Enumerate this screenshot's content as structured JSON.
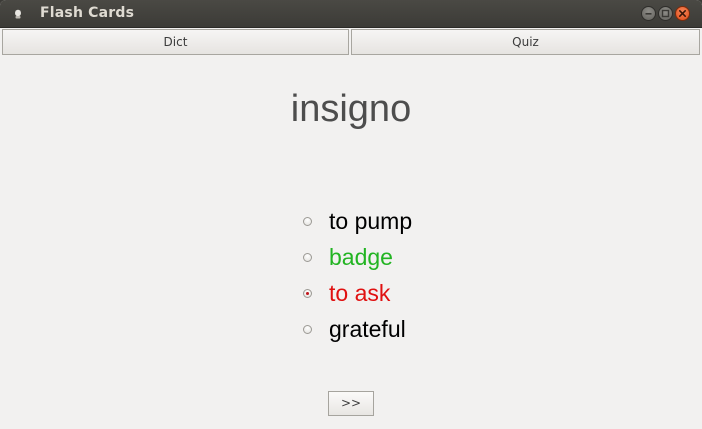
{
  "window": {
    "title": "Flash Cards"
  },
  "tabs": [
    {
      "label": "Dict"
    },
    {
      "label": "Quiz"
    }
  ],
  "quiz": {
    "word": "insigno",
    "options": [
      {
        "label": "to pump",
        "color": "#000000",
        "selected": false
      },
      {
        "label": "badge",
        "color": "#22b422",
        "selected": false
      },
      {
        "label": "to ask",
        "color": "#e01010",
        "selected": true
      },
      {
        "label": "grateful",
        "color": "#000000",
        "selected": false
      }
    ],
    "next_label": ">>"
  },
  "colors": {
    "correct": "#22b422",
    "wrong": "#e01010",
    "close_button": "#df4a16"
  },
  "icons": [
    "app-icon",
    "minimize-icon",
    "maximize-icon",
    "close-icon",
    "radio-icon"
  ]
}
